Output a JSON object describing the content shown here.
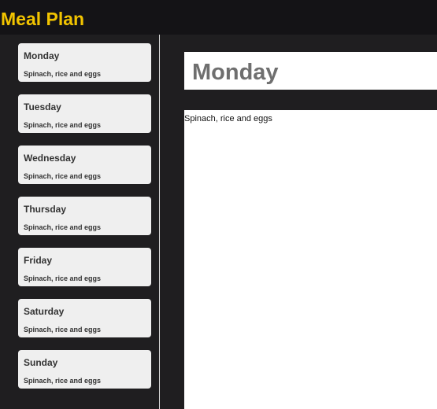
{
  "header": {
    "title": "Meal Plan"
  },
  "sidebar": {
    "items": [
      {
        "day": "Monday",
        "meal": "Spinach, rice and eggs"
      },
      {
        "day": "Tuesday",
        "meal": "Spinach, rice and eggs"
      },
      {
        "day": "Wednesday",
        "meal": "Spinach, rice and eggs"
      },
      {
        "day": "Thursday",
        "meal": "Spinach, rice and eggs"
      },
      {
        "day": "Friday",
        "meal": "Spinach, rice and eggs"
      },
      {
        "day": "Saturday",
        "meal": "Spinach, rice and eggs"
      },
      {
        "day": "Sunday",
        "meal": "Spinach, rice and eggs"
      }
    ]
  },
  "main": {
    "title": "Monday",
    "content": "Spinach, rice and eggs"
  },
  "colors": {
    "background": "#1f1e20",
    "header": "#141316",
    "brand": "#f2c400",
    "card": "#efefef",
    "panel": "#ffffff"
  }
}
